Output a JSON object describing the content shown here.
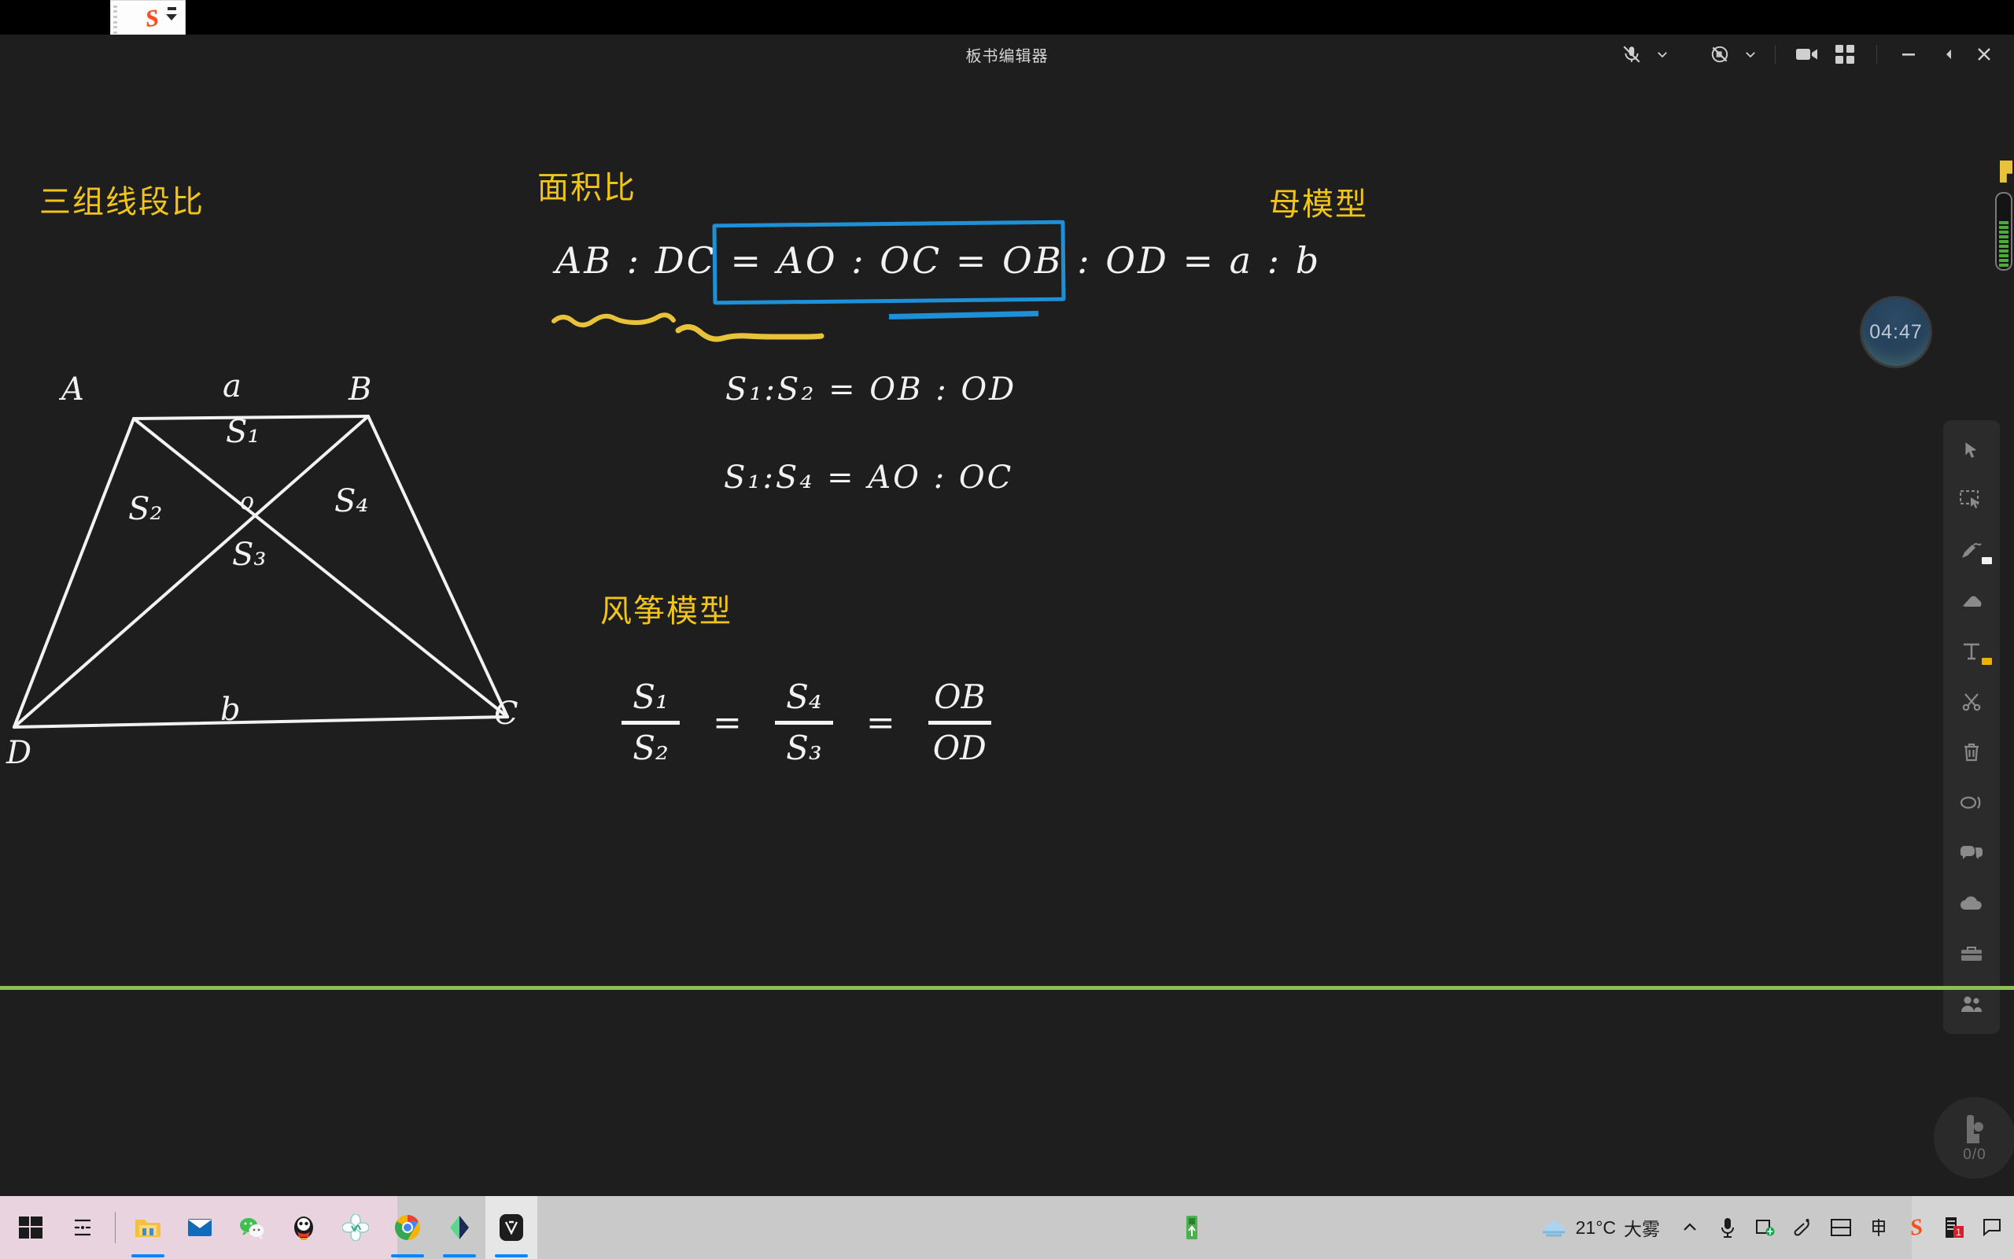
{
  "ime_popup": {
    "app": "sogou-input",
    "logo_text": "S"
  },
  "window": {
    "title": "板书编辑器",
    "controls": {
      "mic": "mic-muted-icon",
      "mic_chevron": "chevron-down-icon",
      "camera": "camera-muted-icon",
      "camera_chevron": "chevron-down-icon",
      "record": "video-camera-icon",
      "layout": "grid-layout-icon",
      "minimize": "minimize-icon",
      "pin": "pin-icon",
      "close": "close-icon"
    }
  },
  "board": {
    "headings": {
      "lines_ratio": "三组线段比",
      "area_ratio": "面积比",
      "mother_model": "母模型",
      "kite_model": "风筝模型"
    },
    "equations": {
      "main": "AB : DC = AO : OC = OB : OD = a : b",
      "main_parts": {
        "lhs": "AB : DC",
        "eq1": "=",
        "mid1": "AO : OC",
        "eq2": "=",
        "mid2": "OB : OD",
        "eq3": "=",
        "rhs": "a : b"
      },
      "s1_s2": "S₁:S₂ = OB : OD",
      "s1_s4": "S₁:S₄ = AO : OC"
    },
    "kite_formula": {
      "f1_num": "S₁",
      "f1_den": "S₂",
      "eq1": "=",
      "f2_num": "S₄",
      "f2_den": "S₃",
      "eq2": "=",
      "f3_num": "OB",
      "f3_den": "OD"
    },
    "figure": {
      "name": "trapezoid-with-diagonals",
      "vertices": {
        "A": "A",
        "B": "B",
        "C": "C",
        "D": "D",
        "O": "o"
      },
      "sides": {
        "top": "a",
        "bottom": "b"
      },
      "areas": {
        "s1": "S₁",
        "s2": "S₂",
        "s3": "S₃",
        "s4": "S₄"
      }
    },
    "timer": "04:47",
    "hand_raise_count": "0/0",
    "accent_colors": {
      "heading_yellow": "#f0c419",
      "chalk_white": "#f2f2f2",
      "highlight_blue": "#1e90d8",
      "underline_yellow": "#e8c33a",
      "rule_green": "#8cc152",
      "board_bg": "#1e1e1e"
    }
  },
  "toolrail": {
    "items": [
      {
        "name": "cursor-select-icon",
        "label": "选择"
      },
      {
        "name": "marquee-select-icon",
        "label": "框选"
      },
      {
        "name": "pen-icon",
        "label": "画笔",
        "swatch": "#f2f2f2"
      },
      {
        "name": "eraser-icon",
        "label": "橡皮"
      },
      {
        "name": "text-tool-icon",
        "label": "文本",
        "swatch": "#e8b200"
      },
      {
        "name": "scissors-icon",
        "label": "剪切"
      },
      {
        "name": "trash-icon",
        "label": "删除"
      },
      {
        "name": "laser-pointer-icon",
        "label": "激光笔"
      },
      {
        "name": "speech-bubble-icon",
        "label": "讨论"
      },
      {
        "name": "cloud-icon",
        "label": "云资源"
      },
      {
        "name": "toolbox-icon",
        "label": "工具箱"
      },
      {
        "name": "people-icon",
        "label": "成员"
      }
    ]
  },
  "taskbar": {
    "start": "windows-start-icon",
    "taskview": "task-view-icon",
    "apps": [
      {
        "name": "file-explorer-icon",
        "running": true
      },
      {
        "name": "mail-icon",
        "running": false
      },
      {
        "name": "wechat-icon",
        "running": false
      },
      {
        "name": "qq-icon",
        "running": false
      },
      {
        "name": "flower-app-icon",
        "running": false
      },
      {
        "name": "chrome-icon",
        "running": true
      },
      {
        "name": "green-app-icon",
        "running": true
      },
      {
        "name": "blackboard-editor-icon",
        "running": true,
        "active": true
      }
    ],
    "usb": "usb-drive-icon",
    "weather": {
      "icon": "fog-icon",
      "temp": "21°C",
      "condition": "大雾"
    },
    "tray": [
      {
        "name": "show-hidden-icons-icon"
      },
      {
        "name": "microphone-icon"
      },
      {
        "name": "screen-capture-icon"
      },
      {
        "name": "pen-clip-icon"
      },
      {
        "name": "split-screen-icon"
      },
      {
        "name": "ime-chinese-icon"
      },
      {
        "name": "sogou-icon"
      },
      {
        "name": "notes-icon",
        "badge": "1"
      },
      {
        "name": "action-center-icon"
      }
    ]
  }
}
